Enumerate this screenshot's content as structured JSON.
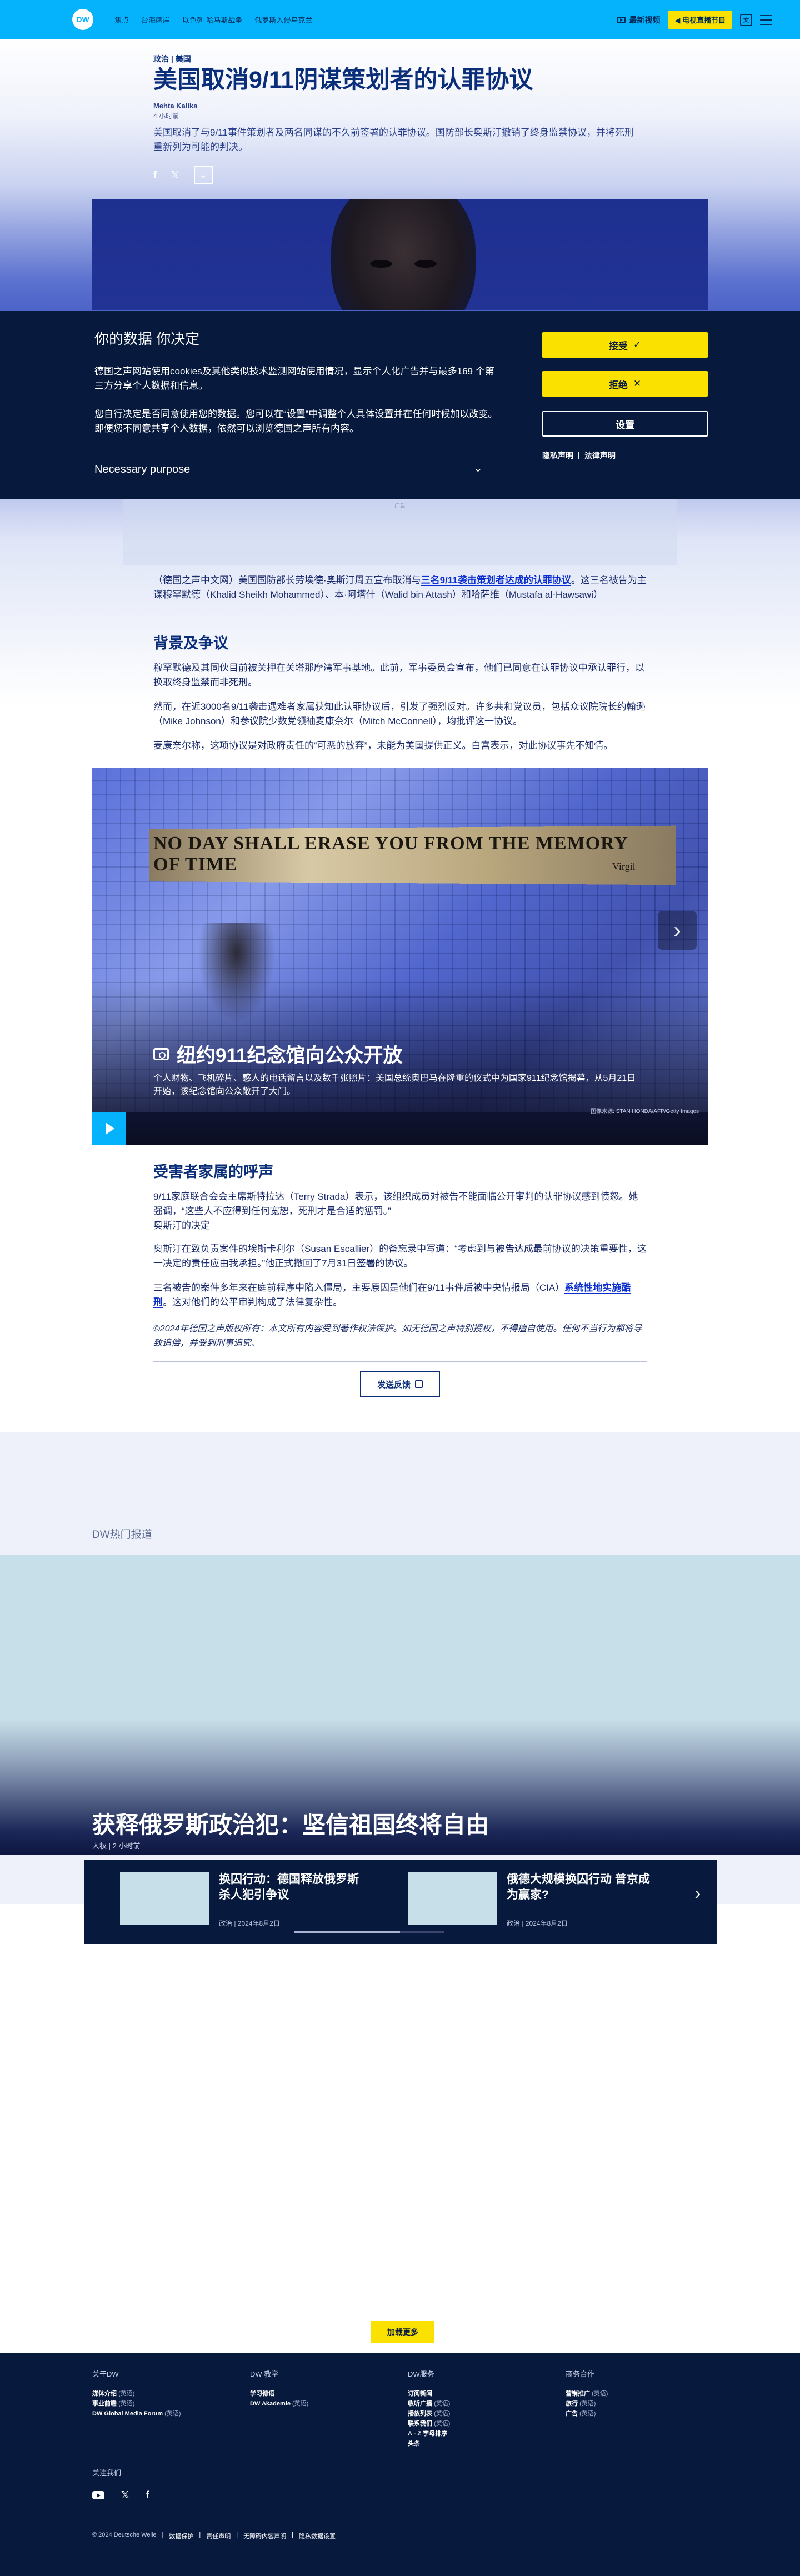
{
  "header": {
    "logo": "DW",
    "nav": [
      "焦点",
      "台海两岸",
      "以色列-哈马斯战争",
      "俄罗斯入侵乌克兰"
    ],
    "live_label": "最新视频",
    "radio_label": "◀ 电视直播节目",
    "lang_icon": "文"
  },
  "article": {
    "kicker": "政治 | 美国",
    "title": "美国取消9/11阴谋策划者的认罪协议",
    "author": "Mehta Kalika",
    "time": "4 小时前",
    "teaser": "美国取消了与9/11事件策划者及两名同谋的不久前签署的认罪协议。国防部长奥斯汀撤销了终身监禁协议，并将死刑重新列为可能的判决。",
    "share": [
      "f",
      "𝕏",
      "⌄"
    ],
    "ad_label": "广告",
    "p1_a": "（德国之声中文网）美国国防部长劳埃德·奥斯汀周五宣布取消与",
    "p1_link": "三名9/11袭击策划者达成的认罪协议",
    "p1_b": "。这三名被告为主谋穆罕默德（Khalid Sheikh Mohammed）、本·阿塔什（Walid bin Attash）和哈萨维（Mustafa al-Hawsawi）",
    "h_background": "背景及争议",
    "p2": "穆罕默德及其同伙目前被关押在关塔那摩湾军事基地。此前，军事委员会宣布，他们已同意在认罪协议中承认罪行，以换取终身监禁而非死刑。",
    "p3": "然而，在近3000名9/11袭击遇难者家属获知此认罪协议后，引发了强烈反对。许多共和党议员，包括众议院院长约翰逊（Mike Johnson）和参议院少数党领袖麦康奈尔（Mitch McConnell），均批评这一协议。",
    "p4": "麦康奈尔称，这项协议是对政府责任的“可恶的放弃”，未能为美国提供正义。白宫表示，对此协议事先不知情。",
    "h_victims": "受害者家属的呼声",
    "p5": "9/11家庭联合会会主席斯特拉达（Terry Strada）表示，该组织成员对被告不能面临公开审判的认罪协议感到愤怒。她强调，“这些人不应得到任何宽恕，死刑才是合适的惩罚。”",
    "p5b": "奥斯汀的决定",
    "p6": "奥斯汀在致负责案件的埃斯卡利尔（Susan Escallier）的备忘录中写道：“考虑到与被告达成最前协议的决策重要性，这一决定的责任应由我承担。”他正式撤回了7月31日签署的协议。",
    "p7_a": "三名被告的案件多年来在庭前程序中陷入僵局，主要原因是他们在9/11事件后被中央情报局（CIA）",
    "p7_link": "系统性地实施酷刑",
    "p7_b": "。这对他们的公平审判构成了法律复杂性。",
    "copyright": "©2024年德国之声版权所有：本文所有内容受到著作权法保护。如无德国之声特别授权，不得擅自使用。任何不当行为都将导致追偿，并受到刑事追究。",
    "feedback": "发送反馈"
  },
  "consent": {
    "title": "你的数据 你决定",
    "p1": "德国之声网站使用cookies及其他类似技术监测网站使用情况，显示个人化广告并与最多169 个第三方分享个人数据和信息。",
    "p2": "您自行决定是否同意使用您的数据。您可以在“设置”中调整个人具体设置并在任何时候加以改变。即便您不同意共享个人数据，依然可以浏览德国之声所有内容。",
    "purpose": "Necessary purpose",
    "accept": "接受",
    "reject": "拒绝",
    "settings": "设置",
    "privacy": "隐私声明",
    "legal": "法律声明"
  },
  "gallery": {
    "plaque": "NO DAY SHALL ERASE YOU FROM THE MEMORY OF TIME",
    "plaque_author": "Virgil",
    "title": "纽约911纪念馆向公众开放",
    "desc": "个人财物、飞机碎片、感人的电话留言以及数千张照片：美国总统奥巴马在隆重的仪式中为国家911纪念馆揭幕，从5月21日开始，该纪念馆向公众敞开了大门。",
    "credit": "图像来源: STAN HONDA/AFP/Getty Images"
  },
  "hot": {
    "label": "DW热门报道",
    "title": "获释俄罗斯政治犯：坚信祖国终将自由",
    "meta": "人权 | 2 小时前",
    "cards": [
      {
        "title": "换囚行动：德国释放俄罗斯杀人犯引争议",
        "meta": "政治 | 2024年8月2日"
      },
      {
        "title": "俄德大规模换囚行动 普京成为赢家?",
        "meta": "政治 | 2024年8月2日"
      }
    ],
    "more": "加载更多"
  },
  "footer": {
    "cols": [
      {
        "title": "关于DW",
        "items": [
          [
            "媒体介绍",
            "(英语)"
          ],
          [
            "事业前瞻",
            "(英语)"
          ],
          [
            "DW Global Media Forum",
            "(英语)"
          ]
        ]
      },
      {
        "title": "DW 教学",
        "items": [
          [
            "学习德语",
            ""
          ],
          [
            "DW Akademie",
            "(英语)"
          ]
        ]
      },
      {
        "title": "DW服务",
        "items": [
          [
            "订阅新闻",
            ""
          ],
          [
            "收听广播",
            "(英语)"
          ],
          [
            "播放列表",
            "(英语)"
          ],
          [
            "联系我们",
            "(英语)"
          ],
          [
            "A - Z 字母排序",
            ""
          ],
          [
            "头条",
            ""
          ]
        ]
      },
      {
        "title": "商务合作",
        "items": [
          [
            "营销推广",
            "(英语)"
          ],
          [
            "旅行",
            "(英语)"
          ],
          [
            "广告",
            "(英语)"
          ]
        ]
      }
    ],
    "follow": "关注我们",
    "legal": [
      "© 2024 Deutsche Welle",
      "数据保护",
      "责任声明",
      "无障碍内容声明",
      "隐私数据设置"
    ]
  }
}
